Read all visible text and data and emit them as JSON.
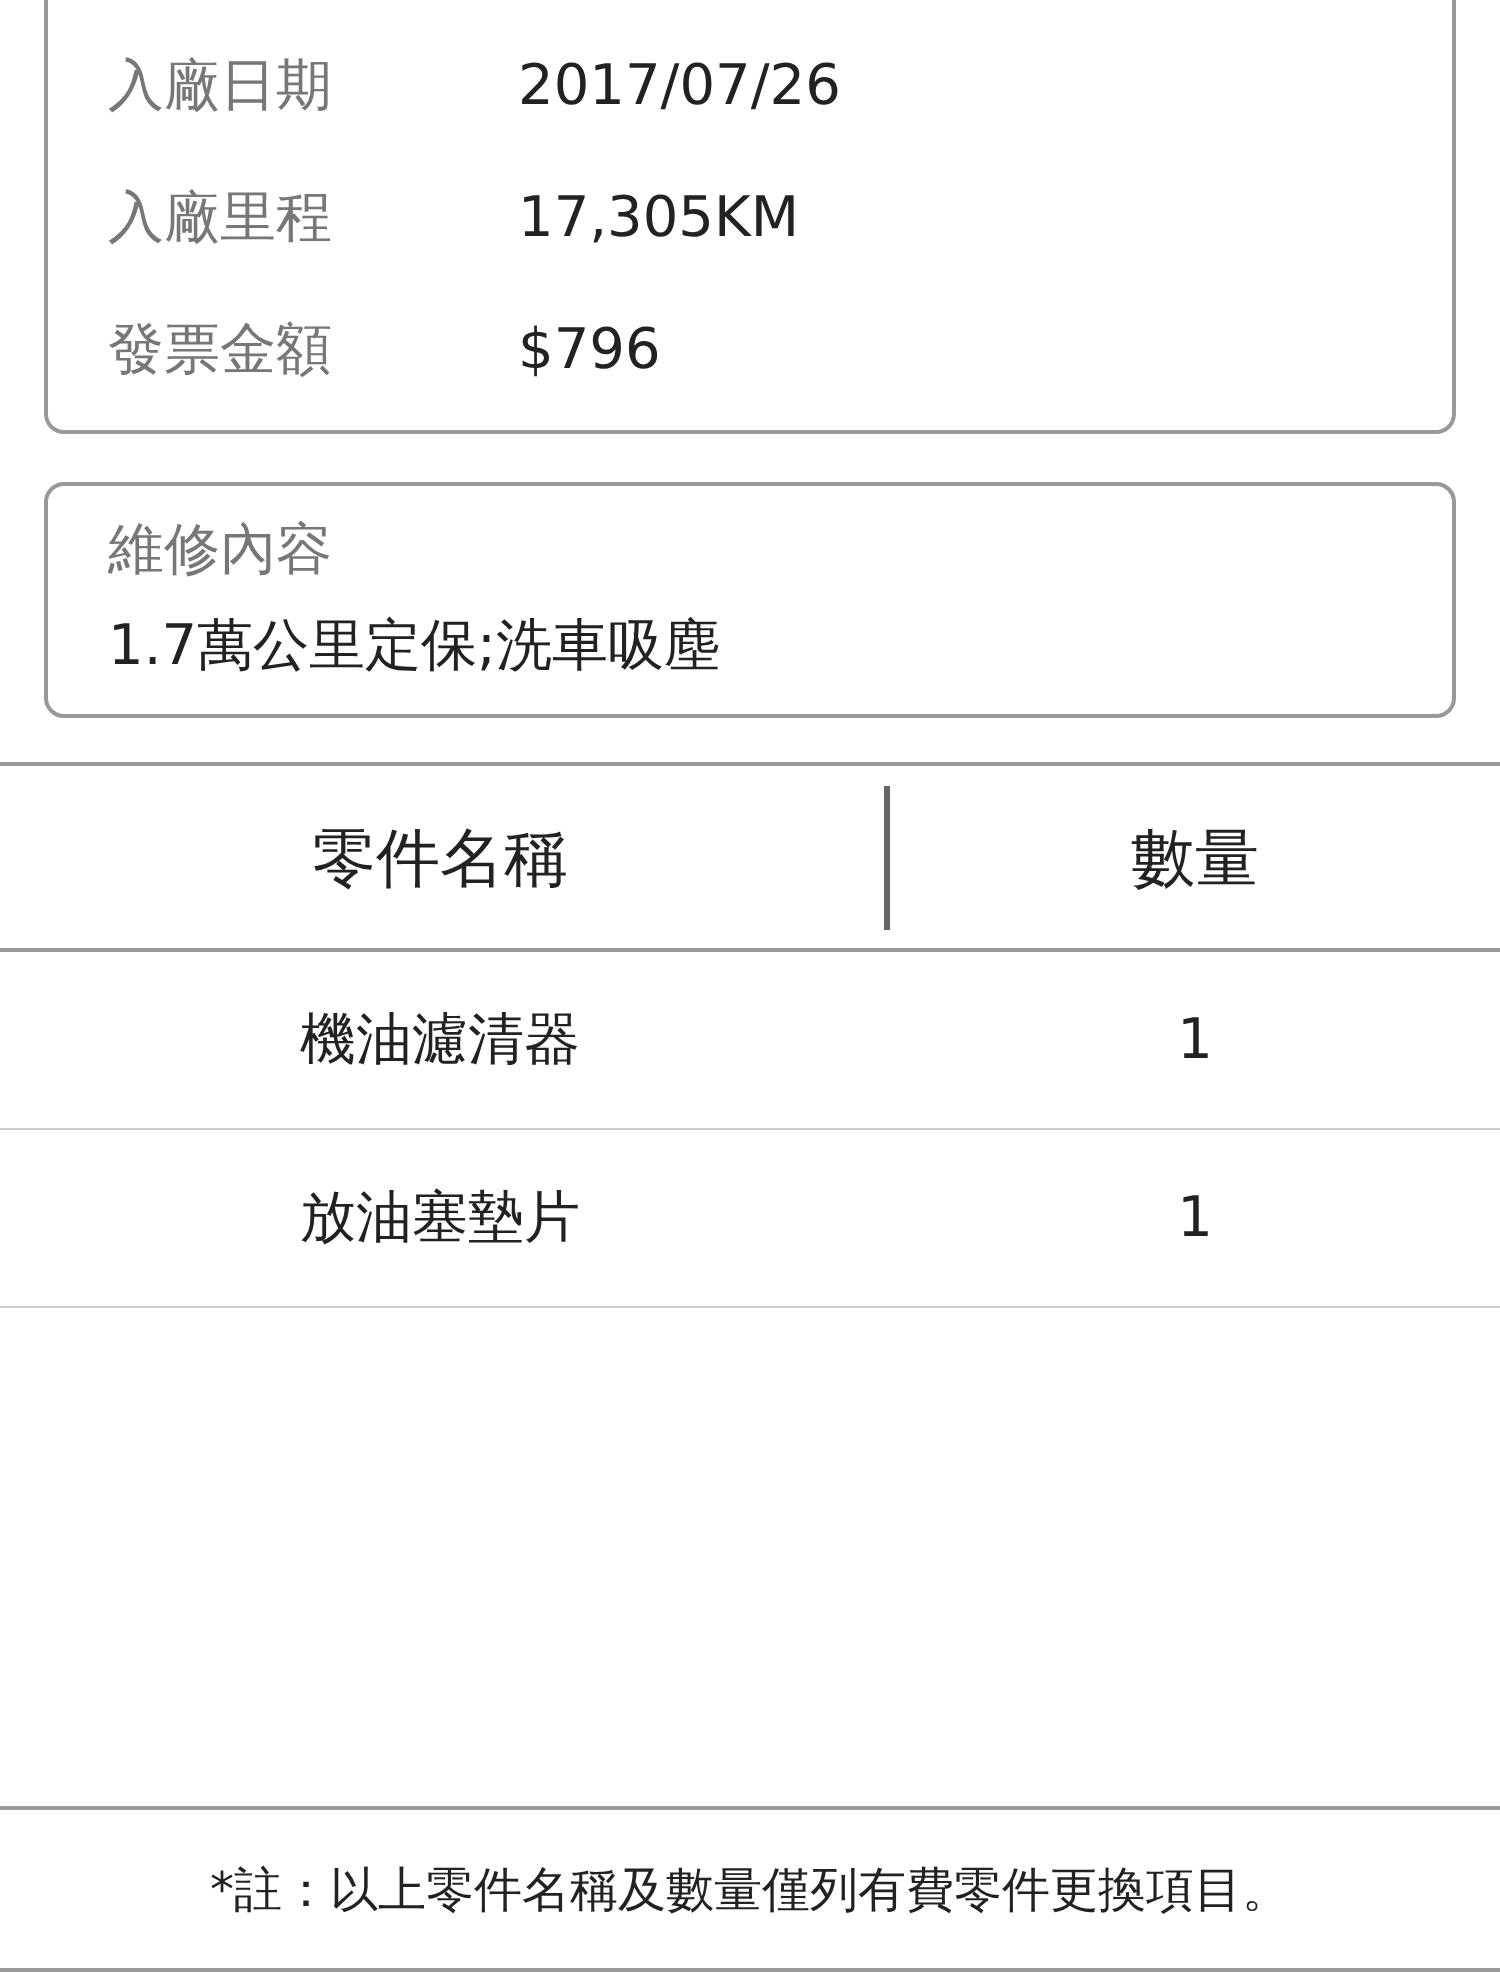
{
  "vehicle_info": {
    "rows": [
      {
        "label": "入廠日期",
        "value": "2017/07/26"
      },
      {
        "label": "入廠里程",
        "value": "17,305KM"
      },
      {
        "label": "發票金額",
        "value": "$796"
      }
    ]
  },
  "service_content": {
    "label": "維修內容",
    "value": "1.7萬公里定保;洗車吸塵"
  },
  "parts_table": {
    "columns": [
      "零件名稱",
      "數量"
    ],
    "rows": [
      [
        "機油濾清器",
        "1"
      ],
      [
        "放油塞墊片",
        "1"
      ]
    ]
  },
  "footnote": "*註：以上零件名稱及數量僅列有費零件更換項目。"
}
